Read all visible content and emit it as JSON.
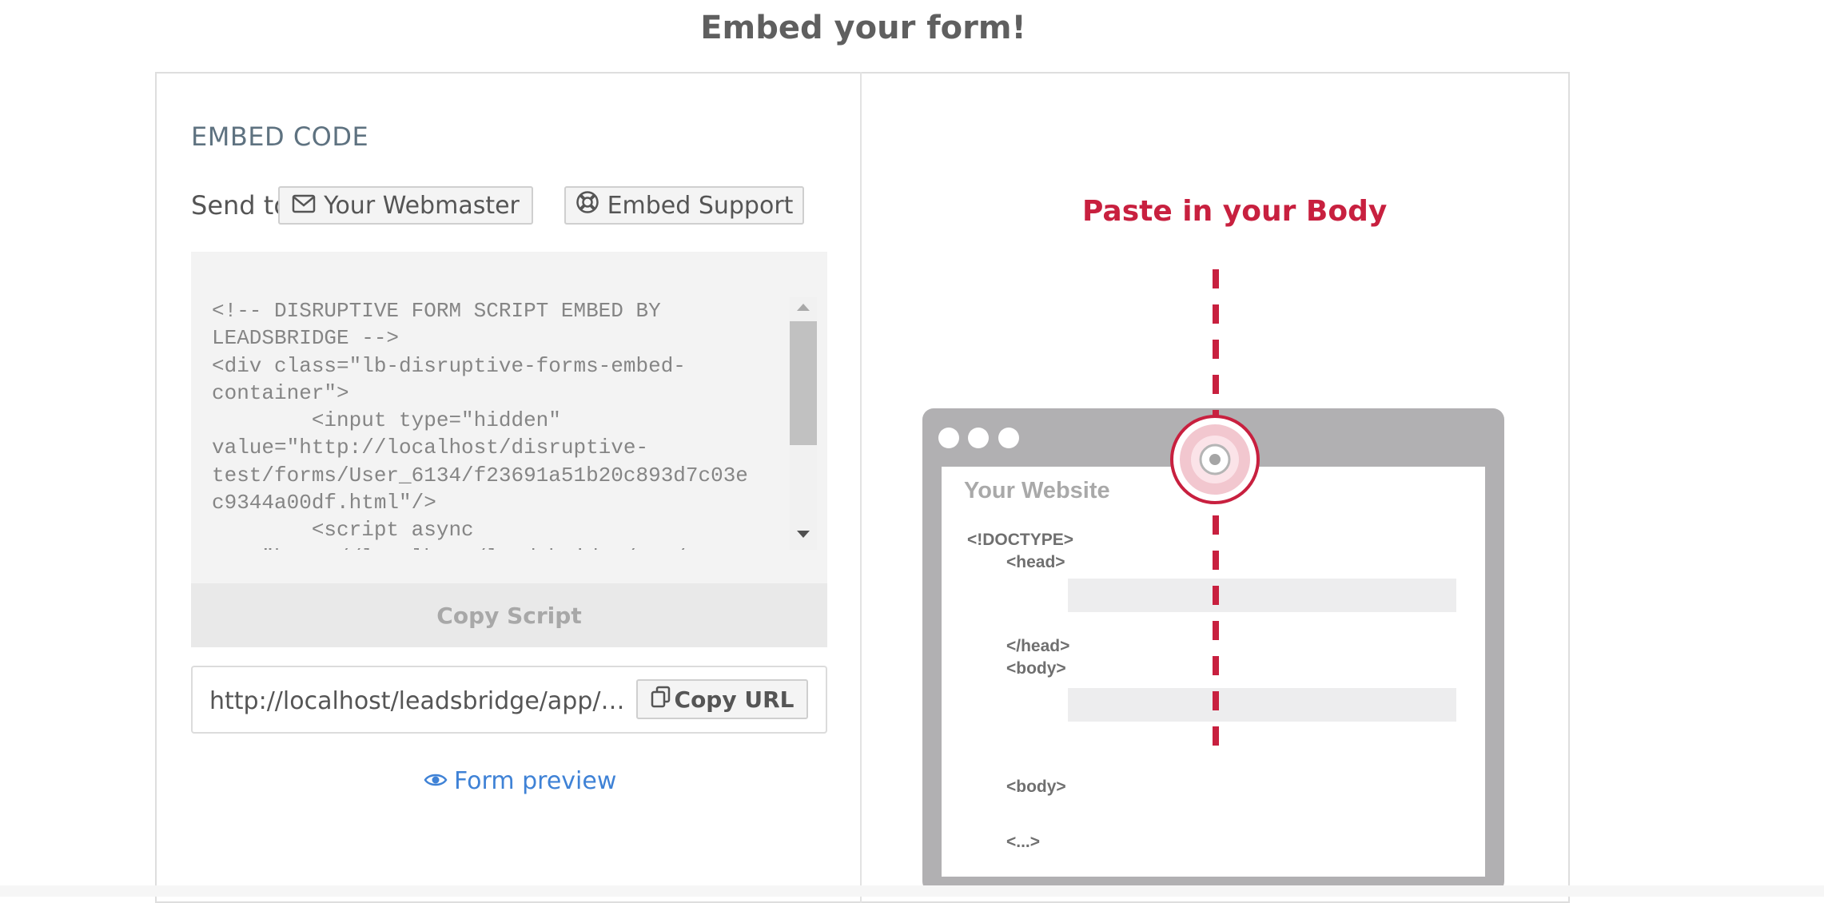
{
  "page": {
    "title": "Embed your form!"
  },
  "embed": {
    "section_title": "EMBED CODE",
    "send_to_label": "Send to",
    "webmaster_button": "Your Webmaster",
    "support_button": "Embed Support",
    "code_lines": [
      "<!-- DISRUPTIVE FORM SCRIPT EMBED BY",
      "LEADSBRIDGE -->",
      "<div class=\"lb-disruptive-forms-embed-",
      "container\">",
      "        <input type=\"hidden\"",
      "value=\"http://localhost/disruptive-",
      "test/forms/User_6134/f23691a51b20c893d7c03e",
      "c9344a00df.html\"/>",
      "        <script async",
      "src=\"http://localhost/leadsbridge/app/assets"
    ],
    "copy_script_label": "Copy Script",
    "url_value": "http://localhost/leadsbridge/app/disruptive-forms/preview",
    "copy_url_label": "Copy URL",
    "preview_link_label": "Form preview"
  },
  "illustration": {
    "title": "Paste in your Body",
    "website_label": "Your Website",
    "lines": {
      "doctype": "<!DOCTYPE>",
      "head_open": "<head>",
      "head_close": "</head>",
      "body_open": "<body>",
      "body_close": "<body>",
      "ellipsis": "<...>"
    },
    "colors": {
      "accent": "#c8203f",
      "frame": "#b1b0b2",
      "placeholder": "#ededee"
    }
  }
}
